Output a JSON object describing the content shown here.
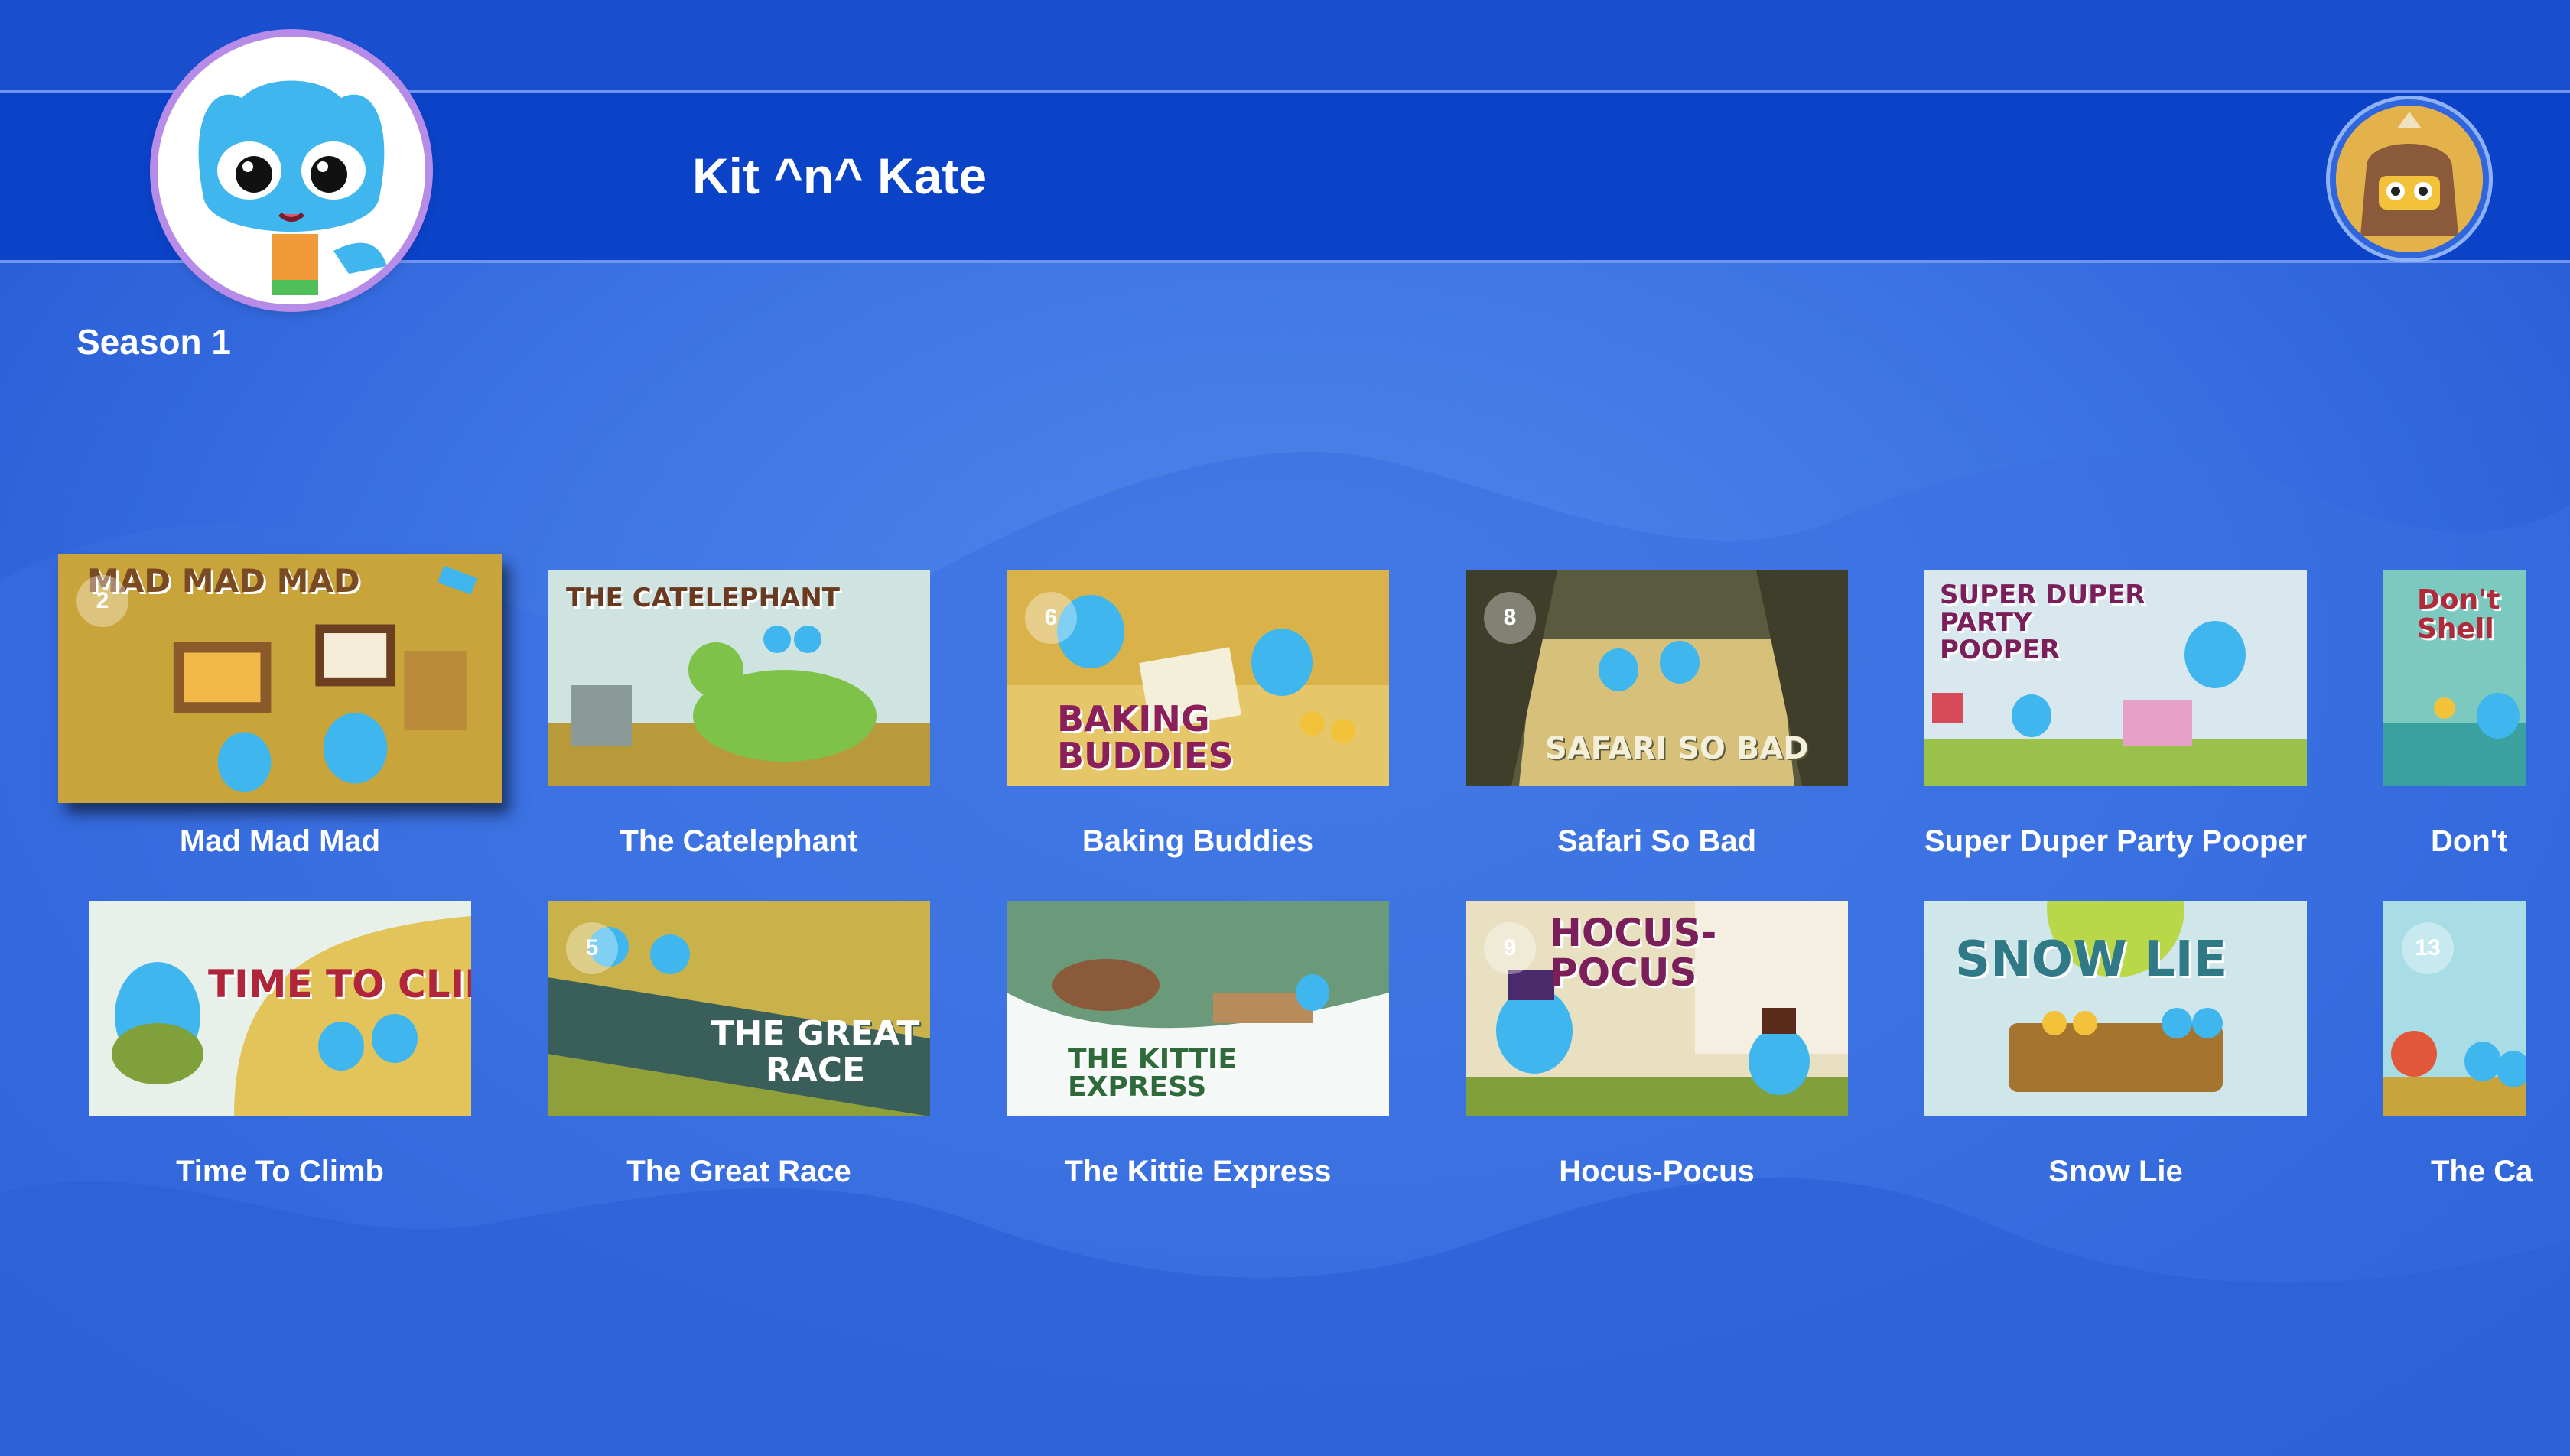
{
  "header": {
    "app_title": "Kit ^n^ Kate",
    "logo_icon": "kit-character-logo",
    "profile_icon": "creature-avatar"
  },
  "season": {
    "label": "Season 1"
  },
  "episodes_row1": [
    {
      "title": "Mad Mad Mad",
      "art_text": "MAD MAD MAD",
      "badge": "2",
      "focused": true,
      "colors": {
        "bg": "#c9a43a",
        "accent": "#7a4a23"
      }
    },
    {
      "title": "The Catelephant",
      "art_text": "THE CATELEPHANT",
      "badge": "",
      "colors": {
        "bg": "#cfe3e0",
        "accent": "#6a3a20"
      }
    },
    {
      "title": "Baking Buddies",
      "art_text": "BAKING BUDDIES",
      "badge": "6",
      "colors": {
        "bg": "#d9b24a",
        "accent": "#8a1f5a"
      }
    },
    {
      "title": "Safari So Bad",
      "art_text": "SAFARI SO BAD",
      "badge": "8",
      "colors": {
        "bg": "#5a5a3e",
        "accent": "#f4efd8"
      }
    },
    {
      "title": "Super Duper Party Pooper",
      "art_text": "SUPER DUPER PARTY POOPER",
      "badge": "",
      "colors": {
        "bg": "#d9e8ef",
        "accent": "#7a1f5a"
      }
    },
    {
      "title": "Don't",
      "art_text": "Don't Shell",
      "badge": "",
      "colors": {
        "bg": "#7cc9c0",
        "accent": "#b02a3a"
      }
    }
  ],
  "episodes_row2": [
    {
      "title": "Time To Climb",
      "art_text": "TIME TO CLIMB",
      "badge": "",
      "colors": {
        "bg": "#e2c45a",
        "accent": "#b0253a"
      }
    },
    {
      "title": "The Great Race",
      "art_text": "THE GREAT RACE",
      "badge": "5",
      "colors": {
        "bg": "#8fa03a",
        "accent": "#ffffff"
      }
    },
    {
      "title": "The Kittie Express",
      "art_text": "THE KITTIE EXPRESS",
      "badge": "",
      "colors": {
        "bg": "#d6ede6",
        "accent": "#2f6a3a"
      }
    },
    {
      "title": "Hocus-Pocus",
      "art_text": "HOCUS-POCUS",
      "badge": "9",
      "colors": {
        "bg": "#e8e0c0",
        "accent": "#7a1f5a"
      }
    },
    {
      "title": "Snow Lie",
      "art_text": "SNOW LIE",
      "badge": "",
      "colors": {
        "bg": "#cfe6ea",
        "accent": "#2f7a86"
      }
    },
    {
      "title": "The Ca",
      "art_text": "",
      "badge": "13",
      "colors": {
        "bg": "#a9dde6",
        "accent": "#2f7a86"
      }
    }
  ]
}
